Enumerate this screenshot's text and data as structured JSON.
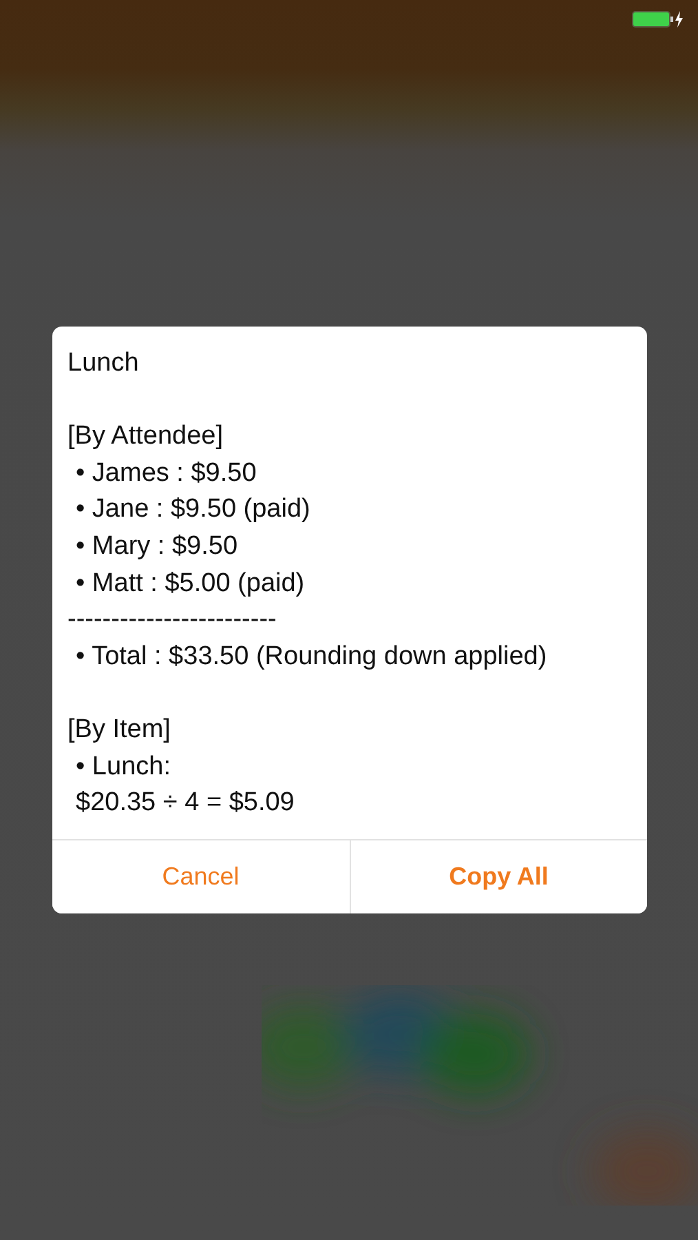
{
  "dialog": {
    "title": "Lunch",
    "sections": [
      {
        "heading": "[By Attendee]",
        "lines": [
          {
            "kind": "indented",
            "text": "• James : $9.50"
          },
          {
            "kind": "indented",
            "text": "• Jane : $9.50 (paid)"
          },
          {
            "kind": "indented",
            "text": "• Mary : $9.50"
          },
          {
            "kind": "indented",
            "text": "• Matt : $5.00 (paid)"
          },
          {
            "kind": "flush",
            "text": "------------------------"
          },
          {
            "kind": "indented",
            "text": "• Total : $33.50 (Rounding down applied)"
          }
        ]
      },
      {
        "heading": "[By Item]",
        "lines": [
          {
            "kind": "indented",
            "text": "• Lunch:"
          },
          {
            "kind": "indented",
            "text": "$20.35 ÷ 4 = $5.09"
          }
        ]
      }
    ],
    "buttons": [
      {
        "kind": "cancel",
        "label": "Cancel"
      },
      {
        "kind": "default",
        "label": "Copy All"
      }
    ]
  }
}
